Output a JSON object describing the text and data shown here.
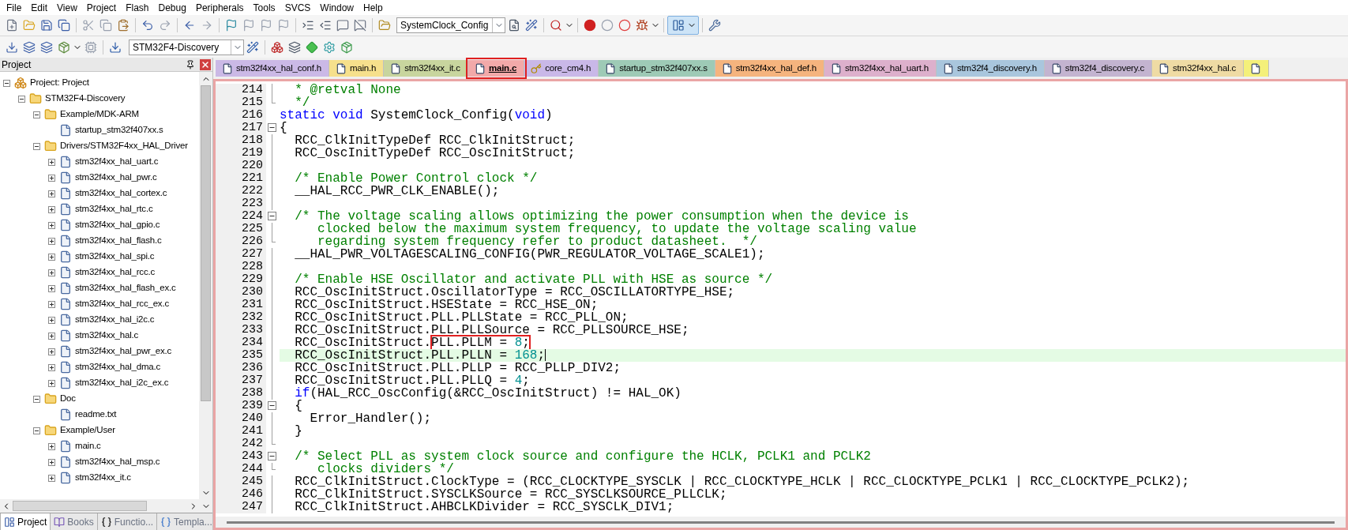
{
  "menu": [
    "File",
    "Edit",
    "View",
    "Project",
    "Flash",
    "Debug",
    "Peripherals",
    "Tools",
    "SVCS",
    "Window",
    "Help"
  ],
  "toolbar": {
    "function_combo": "SystemClock_Config",
    "target_combo": "STM32F4-Discovery"
  },
  "project_panel": {
    "title": "Project",
    "tree": [
      {
        "kind": "project",
        "label": "Project: Project",
        "expanded": true,
        "children": [
          {
            "kind": "target",
            "label": "STM32F4-Discovery",
            "expanded": true,
            "children": [
              {
                "kind": "group",
                "label": "Example/MDK-ARM",
                "expanded": true,
                "children": [
                  {
                    "kind": "file",
                    "label": "startup_stm32f407xx.s"
                  }
                ]
              },
              {
                "kind": "group",
                "label": "Drivers/STM32F4xx_HAL_Driver",
                "expanded": true,
                "children": [
                  {
                    "kind": "file",
                    "label": "stm32f4xx_hal_uart.c",
                    "expanded": false
                  },
                  {
                    "kind": "file",
                    "label": "stm32f4xx_hal_pwr.c",
                    "expanded": false
                  },
                  {
                    "kind": "file",
                    "label": "stm32f4xx_hal_cortex.c",
                    "expanded": false
                  },
                  {
                    "kind": "file",
                    "label": "stm32f4xx_hal_rtc.c",
                    "expanded": false
                  },
                  {
                    "kind": "file",
                    "label": "stm32f4xx_hal_gpio.c",
                    "expanded": false
                  },
                  {
                    "kind": "file",
                    "label": "stm32f4xx_hal_flash.c",
                    "expanded": false
                  },
                  {
                    "kind": "file",
                    "label": "stm32f4xx_hal_spi.c",
                    "expanded": false
                  },
                  {
                    "kind": "file",
                    "label": "stm32f4xx_hal_rcc.c",
                    "expanded": false
                  },
                  {
                    "kind": "file",
                    "label": "stm32f4xx_hal_flash_ex.c",
                    "expanded": false
                  },
                  {
                    "kind": "file",
                    "label": "stm32f4xx_hal_rcc_ex.c",
                    "expanded": false
                  },
                  {
                    "kind": "file",
                    "label": "stm32f4xx_hal_i2c.c",
                    "expanded": false
                  },
                  {
                    "kind": "file",
                    "label": "stm32f4xx_hal.c",
                    "expanded": false
                  },
                  {
                    "kind": "file",
                    "label": "stm32f4xx_hal_pwr_ex.c",
                    "expanded": false
                  },
                  {
                    "kind": "file",
                    "label": "stm32f4xx_hal_dma.c",
                    "expanded": false
                  },
                  {
                    "kind": "file",
                    "label": "stm32f4xx_hal_i2c_ex.c",
                    "expanded": false
                  }
                ]
              },
              {
                "kind": "group",
                "label": "Doc",
                "expanded": true,
                "children": [
                  {
                    "kind": "file",
                    "label": "readme.txt"
                  }
                ]
              },
              {
                "kind": "group",
                "label": "Example/User",
                "expanded": true,
                "children": [
                  {
                    "kind": "file",
                    "label": "main.c",
                    "expanded": false
                  },
                  {
                    "kind": "file",
                    "label": "stm32f4xx_hal_msp.c",
                    "expanded": false
                  },
                  {
                    "kind": "file",
                    "label": "stm32f4xx_it.c",
                    "expanded": false
                  }
                ]
              }
            ]
          }
        ]
      }
    ],
    "bottom_tabs": [
      {
        "kind": "project",
        "label": "Project",
        "selected": true
      },
      {
        "kind": "books",
        "label": "Books",
        "selected": false
      },
      {
        "kind": "functions",
        "label": "Functio...",
        "selected": false
      },
      {
        "kind": "templates",
        "label": "Templa...",
        "selected": false
      }
    ]
  },
  "editor": {
    "tabs": [
      {
        "kind": "file",
        "label": "stm32f4xx_hal_conf.h",
        "color": "#cbb9e6",
        "selected": false,
        "annotated": false
      },
      {
        "kind": "file",
        "label": "main.h",
        "color": "#f6e08c",
        "selected": false,
        "annotated": false
      },
      {
        "kind": "file",
        "label": "stm32f4xx_it.c",
        "color": "#c8d59e",
        "selected": false,
        "annotated": false
      },
      {
        "kind": "file",
        "label": "main.c",
        "color": "#f2a9a9",
        "selected": true,
        "annotated": true
      },
      {
        "kind": "key",
        "label": "core_cm4.h",
        "color": "#c9b8e8",
        "selected": false,
        "annotated": false
      },
      {
        "kind": "file",
        "label": "startup_stm32f407xx.s",
        "color": "#9ecab6",
        "selected": false,
        "annotated": false
      },
      {
        "kind": "file",
        "label": "stm32f4xx_hal_def.h",
        "color": "#f5b47e",
        "selected": false,
        "annotated": false
      },
      {
        "kind": "file",
        "label": "stm32f4xx_hal_uart.h",
        "color": "#ddb0cc",
        "selected": false,
        "annotated": false
      },
      {
        "kind": "file",
        "label": "stm32f4_discovery.h",
        "color": "#a9c6dd",
        "selected": false,
        "annotated": false
      },
      {
        "kind": "file",
        "label": "stm32f4_discovery.c",
        "color": "#c3b4d0",
        "selected": false,
        "annotated": false
      },
      {
        "kind": "file",
        "label": "stm32f4xx_hal.c",
        "color": "#efdba4",
        "selected": false,
        "annotated": false
      },
      {
        "kind": "file",
        "color": "#f4f07a"
      }
    ],
    "lines": [
      {
        "number": "214",
        "fold": {
          "kind": "line"
        },
        "current": false,
        "tokens": [
          {
            "kind": "comment",
            "text": "  * @retval None"
          }
        ]
      },
      {
        "number": "215",
        "fold": {
          "kind": "end"
        },
        "current": false,
        "tokens": [
          {
            "kind": "comment",
            "text": "  */"
          }
        ]
      },
      {
        "number": "216",
        "current": false,
        "tokens": [
          {
            "kind": "keyword",
            "text": "static"
          },
          {
            "kind": "keyword",
            "text": " void"
          },
          {
            "kind": "plain",
            "text": " SystemClock_Config("
          },
          {
            "kind": "keyword",
            "text": "void"
          },
          {
            "kind": "plain",
            "text": ")"
          }
        ]
      },
      {
        "number": "217",
        "fold": {
          "kind": "open"
        },
        "current": false,
        "tokens": [
          {
            "kind": "plain",
            "text": "{"
          }
        ]
      },
      {
        "number": "218",
        "fold": {
          "kind": "line"
        },
        "current": false,
        "tokens": [
          {
            "kind": "plain",
            "text": "  RCC_ClkInitTypeDef RCC_ClkInitStruct;"
          }
        ]
      },
      {
        "number": "219",
        "fold": {
          "kind": "line"
        },
        "current": false,
        "tokens": [
          {
            "kind": "plain",
            "text": "  RCC_OscInitTypeDef RCC_OscInitStruct;"
          }
        ]
      },
      {
        "number": "220",
        "fold": {
          "kind": "line"
        },
        "current": false
      },
      {
        "number": "221",
        "fold": {
          "kind": "line"
        },
        "current": false,
        "tokens": [
          {
            "kind": "comment",
            "text": "  /* Enable Power Control clock */"
          }
        ]
      },
      {
        "number": "222",
        "fold": {
          "kind": "line"
        },
        "current": false,
        "tokens": [
          {
            "kind": "plain",
            "text": "  __HAL_RCC_PWR_CLK_ENABLE();"
          }
        ]
      },
      {
        "number": "223",
        "fold": {
          "kind": "line"
        },
        "current": false
      },
      {
        "number": "224",
        "fold": {
          "kind": "open"
        },
        "current": false,
        "tokens": [
          {
            "kind": "comment",
            "text": "  /* The voltage scaling allows optimizing the power consumption when the device is"
          }
        ]
      },
      {
        "number": "225",
        "fold": {
          "kind": "line"
        },
        "current": false,
        "tokens": [
          {
            "kind": "comment",
            "text": "     clocked below the maximum system frequency, to update the voltage scaling value"
          }
        ]
      },
      {
        "number": "226",
        "fold": {
          "kind": "end"
        },
        "current": false,
        "tokens": [
          {
            "kind": "comment",
            "text": "     regarding system frequency refer to product datasheet.  */"
          }
        ]
      },
      {
        "number": "227",
        "fold": {
          "kind": "line"
        },
        "current": false,
        "tokens": [
          {
            "kind": "plain",
            "text": "  __HAL_PWR_VOLTAGESCALING_CONFIG(PWR_REGULATOR_VOLTAGE_SCALE1);"
          }
        ]
      },
      {
        "number": "228",
        "fold": {
          "kind": "line"
        },
        "current": false
      },
      {
        "number": "229",
        "fold": {
          "kind": "line"
        },
        "current": false,
        "tokens": [
          {
            "kind": "comment",
            "text": "  /* Enable HSE Oscillator and activate PLL with HSE as source */"
          }
        ]
      },
      {
        "number": "230",
        "fold": {
          "kind": "line"
        },
        "current": false,
        "tokens": [
          {
            "kind": "plain",
            "text": "  RCC_OscInitStruct.OscillatorType = RCC_OSCILLATORTYPE_HSE;"
          }
        ]
      },
      {
        "number": "231",
        "fold": {
          "kind": "line"
        },
        "current": false,
        "tokens": [
          {
            "kind": "plain",
            "text": "  RCC_OscInitStruct.HSEState = RCC_HSE_ON;"
          }
        ]
      },
      {
        "number": "232",
        "fold": {
          "kind": "line"
        },
        "current": false,
        "tokens": [
          {
            "kind": "plain",
            "text": "  RCC_OscInitStruct.PLL.PLLState = RCC_PLL_ON;"
          }
        ]
      },
      {
        "number": "233",
        "fold": {
          "kind": "line"
        },
        "current": false,
        "tokens": [
          {
            "kind": "plain",
            "text": "  RCC_OscInitStruct.PLL.PLLSource = RCC_PLLSOURCE_HSE;"
          }
        ]
      },
      {
        "number": "234",
        "fold": {
          "kind": "line"
        },
        "current": false,
        "tokens": [
          {
            "kind": "plain",
            "text": "  RCC_OscInitStruct."
          },
          {
            "kind": "annotation",
            "children": [
              {
                "kind": "plain",
                "text": "PLL.PLLM = "
              },
              {
                "kind": "number",
                "text": "8"
              },
              {
                "kind": "plain",
                "text": ";"
              }
            ]
          }
        ]
      },
      {
        "number": "235",
        "fold": {
          "kind": "line"
        },
        "current": true,
        "tokens": [
          {
            "kind": "plain",
            "text": "  RCC_OscInitStruct.PLL.PLLN = "
          },
          {
            "kind": "number",
            "text": "168"
          },
          {
            "kind": "plain",
            "text": ";"
          }
        ]
      },
      {
        "number": "236",
        "fold": {
          "kind": "line"
        },
        "current": false,
        "tokens": [
          {
            "kind": "plain",
            "text": "  RCC_OscInitStruct.PLL.PLLP = RCC_PLLP_DIV2;"
          }
        ]
      },
      {
        "number": "237",
        "fold": {
          "kind": "line"
        },
        "current": false,
        "tokens": [
          {
            "kind": "plain",
            "text": "  RCC_OscInitStruct.PLL.PLLQ = "
          },
          {
            "kind": "number",
            "text": "4"
          },
          {
            "kind": "plain",
            "text": ";"
          }
        ]
      },
      {
        "number": "238",
        "fold": {
          "kind": "line"
        },
        "current": false,
        "tokens": [
          {
            "kind": "keyword",
            "text": "  if"
          },
          {
            "kind": "plain",
            "text": "(HAL_RCC_OscConfig(&RCC_OscInitStruct) != HAL_OK)"
          }
        ]
      },
      {
        "number": "239",
        "fold": {
          "kind": "open"
        },
        "current": false,
        "tokens": [
          {
            "kind": "plain",
            "text": "  {"
          }
        ]
      },
      {
        "number": "240",
        "fold": {
          "kind": "line"
        },
        "current": false,
        "tokens": [
          {
            "kind": "plain",
            "text": "    Error_Handler();"
          }
        ]
      },
      {
        "number": "241",
        "fold": {
          "kind": "line"
        },
        "current": false,
        "tokens": [
          {
            "kind": "plain",
            "text": "  }"
          }
        ]
      },
      {
        "number": "242",
        "fold": {
          "kind": "end"
        },
        "current": false
      },
      {
        "number": "243",
        "fold": {
          "kind": "open"
        },
        "current": false,
        "tokens": [
          {
            "kind": "comment",
            "text": "  /* Select PLL as system clock source and configure the HCLK, PCLK1 and PCLK2"
          }
        ]
      },
      {
        "number": "244",
        "fold": {
          "kind": "end"
        },
        "current": false,
        "tokens": [
          {
            "kind": "comment",
            "text": "     clocks dividers */"
          }
        ]
      },
      {
        "number": "245",
        "fold": {
          "kind": "line"
        },
        "current": false,
        "tokens": [
          {
            "kind": "plain",
            "text": "  RCC_ClkInitStruct.ClockType = (RCC_CLOCKTYPE_SYSCLK | RCC_CLOCKTYPE_HCLK | RCC_CLOCKTYPE_PCLK1 | RCC_CLOCKTYPE_PCLK2);"
          }
        ]
      },
      {
        "number": "246",
        "fold": {
          "kind": "line"
        },
        "current": false,
        "tokens": [
          {
            "kind": "plain",
            "text": "  RCC_ClkInitStruct.SYSCLKSource = RCC_SYSCLKSOURCE_PLLCLK;"
          }
        ]
      },
      {
        "number": "247",
        "fold": {
          "kind": "line"
        },
        "current": false,
        "tokens": [
          {
            "kind": "plain",
            "text": "  RCC_ClkInitStruct.AHBCLKDivider = RCC_SYSCLK_DIV1;"
          }
        ]
      }
    ]
  }
}
